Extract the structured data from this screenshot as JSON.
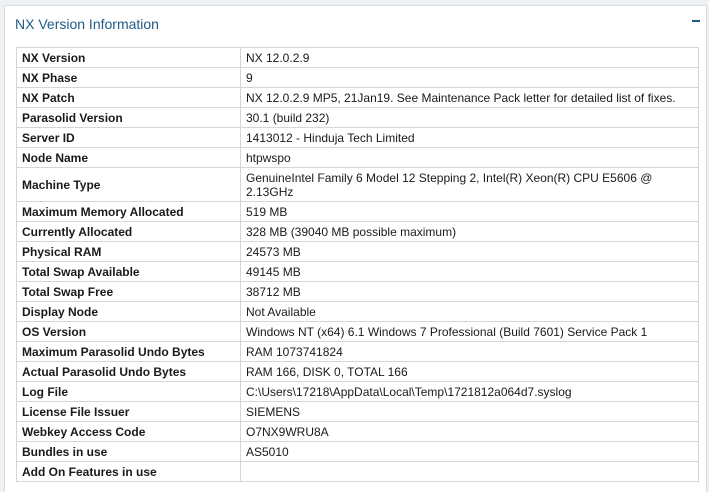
{
  "panel": {
    "title": "NX Version Information"
  },
  "rows": [
    {
      "key": "NX Version",
      "value": "NX 12.0.2.9"
    },
    {
      "key": "NX Phase",
      "value": "9"
    },
    {
      "key": "NX Patch",
      "value": "NX 12.0.2.9 MP5, 21Jan19. See Maintenance Pack letter for detailed list of fixes."
    },
    {
      "key": "Parasolid Version",
      "value": "30.1 (build 232)"
    },
    {
      "key": "Server ID",
      "value": "1413012 - Hinduja Tech Limited"
    },
    {
      "key": "Node Name",
      "value": "htpwspo"
    },
    {
      "key": "Machine Type",
      "value": "GenuineIntel Family 6 Model 12 Stepping 2, Intel(R) Xeon(R) CPU E5606 @ 2.13GHz"
    },
    {
      "key": "Maximum Memory Allocated",
      "value": "519 MB"
    },
    {
      "key": "Currently Allocated",
      "value": "328 MB (39040 MB possible maximum)"
    },
    {
      "key": "Physical RAM",
      "value": "24573 MB"
    },
    {
      "key": "Total Swap Available",
      "value": "49145 MB"
    },
    {
      "key": "Total Swap Free",
      "value": "38712 MB"
    },
    {
      "key": "Display Node",
      "value": "Not Available"
    },
    {
      "key": "OS Version",
      "value": "Windows NT (x64) 6.1 Windows 7 Professional (Build 7601) Service Pack 1"
    },
    {
      "key": "Maximum Parasolid Undo Bytes",
      "value": "RAM 1073741824"
    },
    {
      "key": "Actual Parasolid Undo Bytes",
      "value": "RAM 166, DISK 0, TOTAL 166"
    },
    {
      "key": "Log File",
      "value": "C:\\Users\\17218\\AppData\\Local\\Temp\\1721812a064d7.syslog"
    },
    {
      "key": "License File Issuer",
      "value": "SIEMENS"
    },
    {
      "key": "Webkey Access Code",
      "value": "O7NX9WRU8A"
    },
    {
      "key": "Bundles in use",
      "value": "AS5010"
    },
    {
      "key": "Add On Features in use",
      "value": ""
    }
  ],
  "icons": {
    "collapse": "minus-icon"
  },
  "colors": {
    "title": "#1e5b86",
    "border": "#d4d7da",
    "background": "#eef1f4"
  }
}
